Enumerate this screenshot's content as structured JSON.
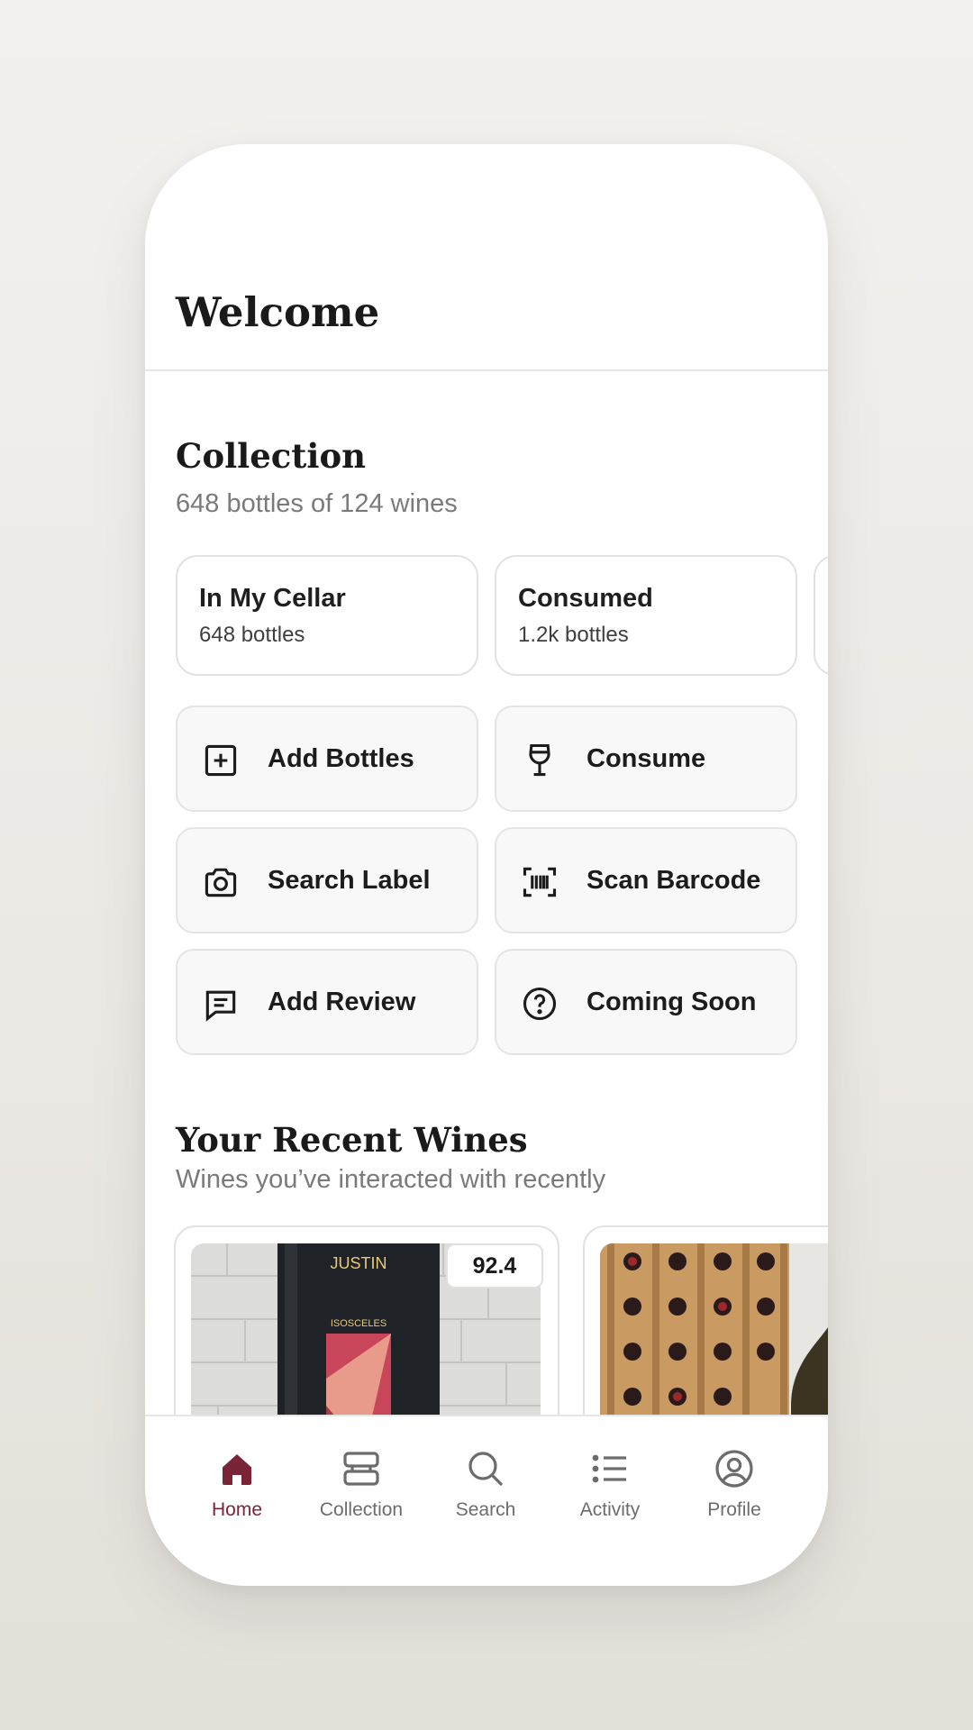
{
  "header": {
    "title": "Welcome"
  },
  "collection": {
    "title": "Collection",
    "summary": "648 bottles of 124 wines",
    "cards": [
      {
        "title": "In My Cellar",
        "subtitle": "648 bottles"
      },
      {
        "title": "Consumed",
        "subtitle": "1.2k bottles"
      }
    ]
  },
  "actions": [
    {
      "label": "Add Bottles",
      "icon": "plus-square-icon"
    },
    {
      "label": "Consume",
      "icon": "wine-glass-icon"
    },
    {
      "label": "Search Label",
      "icon": "camera-icon"
    },
    {
      "label": "Scan Barcode",
      "icon": "barcode-icon"
    },
    {
      "label": "Add Review",
      "icon": "message-icon"
    },
    {
      "label": "Coming Soon",
      "icon": "question-icon"
    }
  ],
  "recent": {
    "title": "Your Recent Wines",
    "subtitle": "Wines you’ve interacted with recently",
    "wines": [
      {
        "score": "92.4",
        "label_brand": "JUSTIN",
        "label_name": "ISOSCELES"
      },
      {
        "score": ""
      }
    ]
  },
  "tabs": [
    {
      "label": "Home",
      "icon": "home-icon",
      "active": true
    },
    {
      "label": "Collection",
      "icon": "collection-icon",
      "active": false
    },
    {
      "label": "Search",
      "icon": "search-icon",
      "active": false
    },
    {
      "label": "Activity",
      "icon": "list-icon",
      "active": false
    },
    {
      "label": "Profile",
      "icon": "profile-icon",
      "active": false
    }
  ],
  "colors": {
    "accent": "#7a2438",
    "text": "#1a1a1a",
    "muted": "#7a7a7a"
  }
}
